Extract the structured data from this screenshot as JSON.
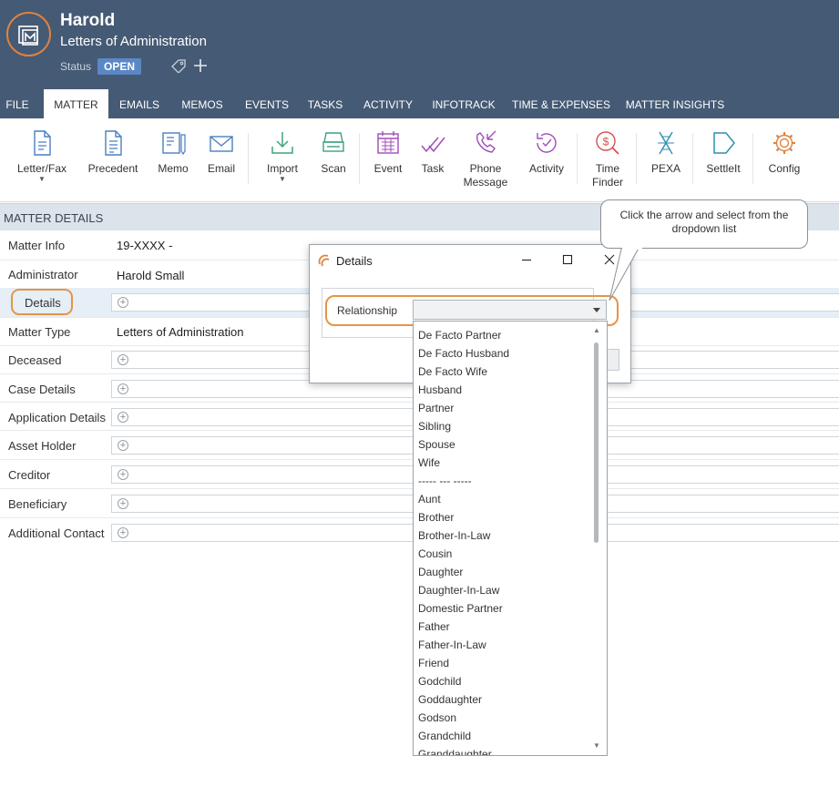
{
  "header": {
    "matter_name": "Harold",
    "matter_type": "Letters of Administration",
    "status_label": "Status",
    "status_value": "OPEN",
    "colors": {
      "header_bg": "#455a74",
      "accent": "#e0833f",
      "status_badge": "#5b87c5"
    }
  },
  "tabs": [
    {
      "label": "FILE"
    },
    {
      "label": "MATTER"
    },
    {
      "label": "EMAILS"
    },
    {
      "label": "MEMOS"
    },
    {
      "label": "EVENTS"
    },
    {
      "label": "TASKS"
    },
    {
      "label": "ACTIVITY"
    },
    {
      "label": "INFOTRACK"
    },
    {
      "label": "TIME & EXPENSES"
    },
    {
      "label": "MATTER INSIGHTS"
    }
  ],
  "active_tab": "MATTER",
  "ribbon": [
    {
      "label": "Letter/Fax",
      "icon": "letter-fax-icon",
      "caret": "▼"
    },
    {
      "label": "Precedent",
      "icon": "precedent-icon"
    },
    {
      "label": "Memo",
      "icon": "memo-icon"
    },
    {
      "label": "Email",
      "icon": "email-icon"
    },
    {
      "label": "Import",
      "icon": "import-icon",
      "caret": "▼"
    },
    {
      "label": "Scan",
      "icon": "scan-icon"
    },
    {
      "label": "Event",
      "icon": "calendar-icon"
    },
    {
      "label": "Task",
      "icon": "task-icon"
    },
    {
      "label": "Phone",
      "label2": "Message",
      "icon": "phone-message-icon"
    },
    {
      "label": "Activity",
      "icon": "activity-icon"
    },
    {
      "label": "Time",
      "label2": "Finder",
      "icon": "time-finder-icon"
    },
    {
      "label": "PEXA",
      "icon": "pexa-icon"
    },
    {
      "label": "SettleIt",
      "icon": "settleit-icon"
    },
    {
      "label": "Config",
      "icon": "gear-icon"
    }
  ],
  "matter_details": {
    "heading": "MATTER DETAILS",
    "rows": [
      {
        "label": "Matter Info",
        "value": "19-XXXX -"
      },
      {
        "label": "Administrator",
        "value": "Harold Small"
      },
      {
        "label": "Details",
        "value": ""
      },
      {
        "label": "Matter Type",
        "value": "Letters of Administration"
      },
      {
        "label": "Deceased",
        "value": ""
      },
      {
        "label": "Case Details",
        "value": ""
      },
      {
        "label": "Application Details",
        "value": ""
      },
      {
        "label": "Asset Holder",
        "value": ""
      },
      {
        "label": "Creditor",
        "value": ""
      },
      {
        "label": "Beneficiary",
        "value": ""
      },
      {
        "label": "Additional Contact",
        "value": ""
      }
    ],
    "add_symbol": "+"
  },
  "dialog": {
    "title": "Details",
    "field_label": "Relationship",
    "field_value": "",
    "options": [
      "De Facto Partner",
      "De Facto Husband",
      "De Facto Wife",
      "Husband",
      "Partner",
      "Sibling",
      "Spouse",
      "Wife",
      "----- --- -----",
      "Aunt",
      "Brother",
      "Brother-In-Law",
      "Cousin",
      "Daughter",
      "Daughter-In-Law",
      "Domestic Partner",
      "Father",
      "Father-In-Law",
      "Friend",
      "Godchild",
      "Goddaughter",
      "Godson",
      "Grandchild",
      "Granddaughter"
    ]
  },
  "callout": {
    "text": "Click the arrow and select from the dropdown list"
  }
}
